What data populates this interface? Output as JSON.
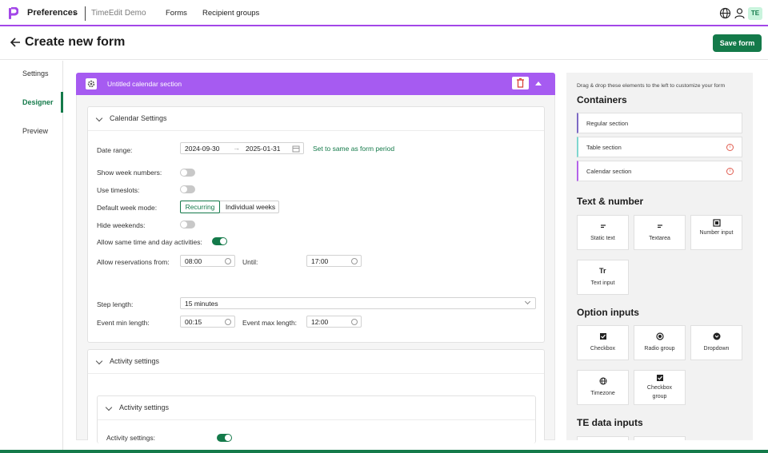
{
  "topnav": {
    "app_name": "Preferences",
    "org_name": "TimeEdit Demo",
    "links": [
      "Forms",
      "Recipient groups"
    ],
    "badge": "TE"
  },
  "header": {
    "title": "Create new form",
    "save_label": "Save form"
  },
  "left_tabs": [
    "Settings",
    "Designer",
    "Preview"
  ],
  "section": {
    "title": "Untitled calendar section"
  },
  "calendar_settings": {
    "title": "Calendar Settings",
    "date_range_label": "Date range:",
    "date_start": "2024-09-30",
    "date_end": "2025-01-31",
    "set_same_link": "Set to same as form period",
    "show_week_numbers_label": "Show week numbers:",
    "use_timeslots_label": "Use timeslots:",
    "default_week_mode_label": "Default week mode:",
    "mode_recurring": "Recurring",
    "mode_individual": "Individual weeks",
    "hide_weekends_label": "Hide weekends:",
    "allow_same_label": "Allow same time and day activities:",
    "allow_res_label": "Allow reservations from:",
    "allow_from": "08:00",
    "until_label": "Until:",
    "until_value": "17:00",
    "step_length_label": "Step length:",
    "step_length_value": "15 minutes",
    "event_min_label": "Event min length:",
    "event_min_value": "00:15",
    "event_max_label": "Event max length:",
    "event_max_value": "12:00"
  },
  "activity_settings": {
    "title": "Activity settings",
    "inner_title": "Activity settings",
    "row_label": "Activity settings:"
  },
  "panel": {
    "hint": "Drag & drop these elements to the left to customize your form",
    "containers_title": "Containers",
    "containers": [
      "Regular section",
      "Table section",
      "Calendar section"
    ],
    "text_number_title": "Text & number",
    "text_number": [
      "Static text",
      "Textarea",
      "Number input",
      "Text input"
    ],
    "option_inputs_title": "Option inputs",
    "option_inputs": [
      "Checkbox",
      "Radio group",
      "Dropdown",
      "Timezone",
      "Checkbox group"
    ],
    "te_data_title": "TE data inputs"
  },
  "colors": {
    "accent_green": "#147a4a",
    "section_purple": "#a65bf1",
    "nav_purple": "#a347e8"
  }
}
